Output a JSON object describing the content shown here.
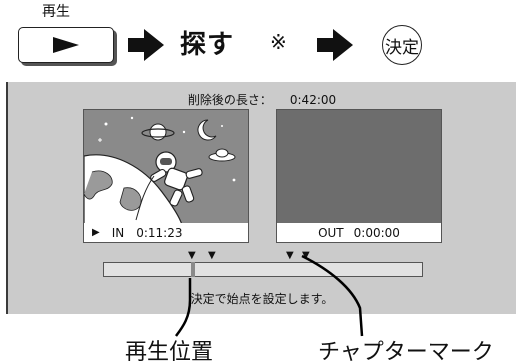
{
  "top_bar": {
    "play_caption": "再生",
    "play_button_icon": "play-triangle",
    "arrow_icon": "right-arrow",
    "search_label": "探す",
    "note_mark": "※",
    "enter_label": "決定"
  },
  "screen": {
    "length_label": "削除後の長さ：",
    "length_value": "0:42:00",
    "in_frame": {
      "play_icon": "▶",
      "label": "IN",
      "time": "0:11:23",
      "illustration": "astronaut-in-space"
    },
    "out_frame": {
      "label": "OUT",
      "time": "0:00:00"
    },
    "chapter_mark_glyph": "▼",
    "instruction": "決定で始点を設定します。"
  },
  "callouts": {
    "playback_position": "再生位置",
    "chapter_mark": "チャプターマーク"
  },
  "colors": {
    "panel": "#cbcbcb",
    "in_frame_bg": "#8a8a8a",
    "out_frame_bg": "#6d6d6d",
    "label_bg": "#ffffff"
  }
}
